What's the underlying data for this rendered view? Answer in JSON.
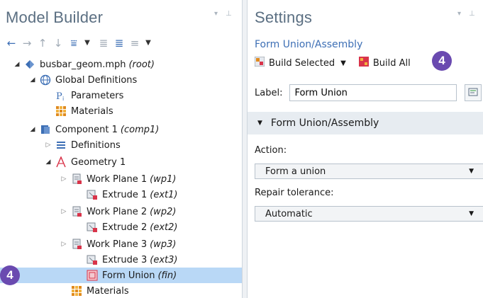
{
  "model_builder": {
    "title": "Model Builder",
    "toolbar_icons": [
      "arrow-left-icon",
      "arrow-right-icon",
      "arrow-up-icon",
      "arrow-down-icon",
      "filter-icon",
      "chevron-down-icon",
      "expand-all-icon",
      "collapse-all-icon",
      "list-icon",
      "chevron-down-icon"
    ],
    "tree": [
      {
        "label": "busbar_geom.mph",
        "tag": "(root)",
        "icon": "root-model-icon",
        "expander": "down"
      },
      {
        "label": "Global Definitions",
        "tag": "",
        "icon": "globe-icon",
        "expander": "down"
      },
      {
        "label": "Parameters",
        "tag": "",
        "icon": "parameters-icon",
        "expander": ""
      },
      {
        "label": "Materials",
        "tag": "",
        "icon": "materials-icon",
        "expander": ""
      },
      {
        "label": "Component 1",
        "tag": "(comp1)",
        "icon": "component-icon",
        "expander": "down"
      },
      {
        "label": "Definitions",
        "tag": "",
        "icon": "definitions-icon",
        "expander": "right"
      },
      {
        "label": "Geometry 1",
        "tag": "",
        "icon": "geometry-icon",
        "expander": "down"
      },
      {
        "label": "Work Plane 1",
        "tag": "(wp1)",
        "icon": "work-plane-icon",
        "expander": "right"
      },
      {
        "label": "Extrude 1",
        "tag": "(ext1)",
        "icon": "extrude-icon",
        "expander": ""
      },
      {
        "label": "Work Plane 2",
        "tag": "(wp2)",
        "icon": "work-plane-icon",
        "expander": "right"
      },
      {
        "label": "Extrude 2",
        "tag": "(ext2)",
        "icon": "extrude-icon",
        "expander": ""
      },
      {
        "label": "Work Plane 3",
        "tag": "(wp3)",
        "icon": "work-plane-icon",
        "expander": "right"
      },
      {
        "label": "Extrude 3",
        "tag": "(ext3)",
        "icon": "extrude-icon",
        "expander": ""
      },
      {
        "label": "Form Union",
        "tag": "(fin)",
        "icon": "form-union-icon",
        "expander": ""
      },
      {
        "label": "Materials",
        "tag": "",
        "icon": "materials-icon",
        "expander": ""
      }
    ],
    "step_badge": "4"
  },
  "settings": {
    "title": "Settings",
    "subtitle": "Form Union/Assembly",
    "build_selected_label": "Build Selected",
    "build_all_label": "Build All",
    "step_badge": "4",
    "label_caption": "Label:",
    "label_value": "Form Union",
    "section_title": "Form Union/Assembly",
    "action_label": "Action:",
    "action_value": "Form a union",
    "repair_label": "Repair tolerance:",
    "repair_value": "Automatic"
  },
  "colors": {
    "accent": "#3d6fb5",
    "selection": "#b9d8f6",
    "badge": "#6a4ab0",
    "title": "#5b6f82"
  }
}
